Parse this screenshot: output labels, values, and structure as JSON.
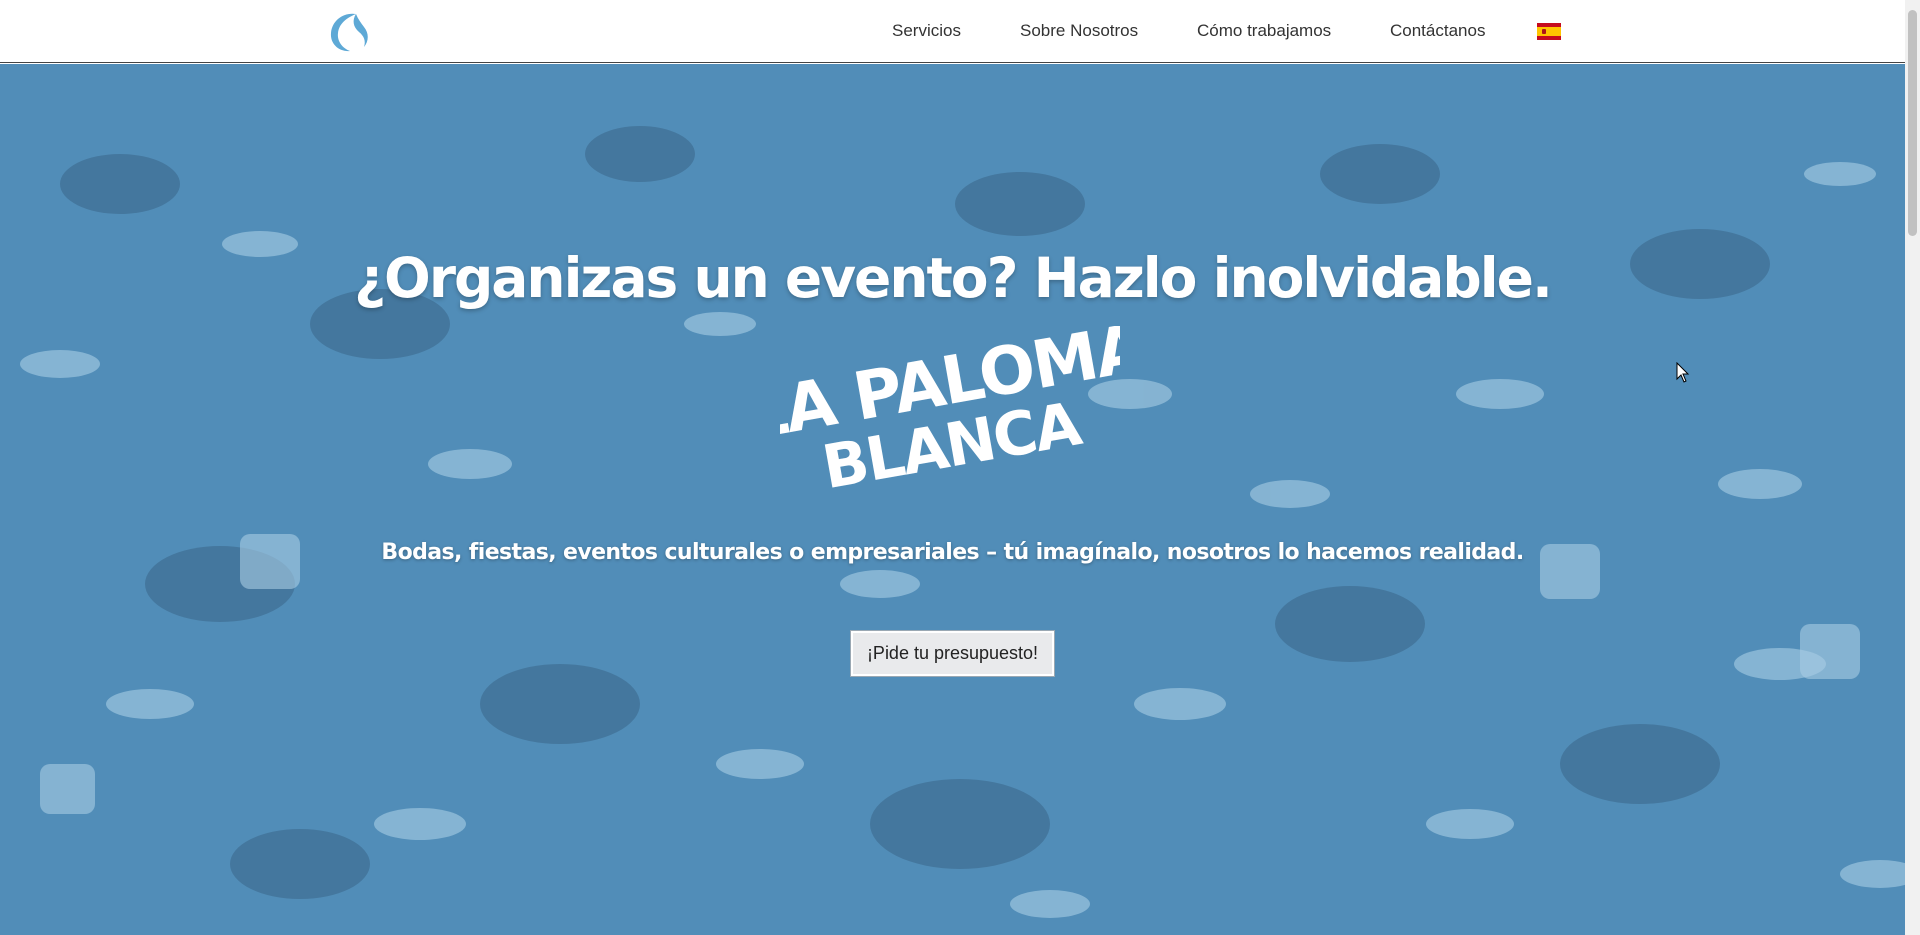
{
  "nav": {
    "logo_icon": "dove-icon",
    "links": [
      "Servicios",
      "Sobre Nosotros",
      "Cómo trabajamos",
      "Contáctanos"
    ],
    "language_icon": "spain-flag-icon"
  },
  "hero": {
    "title": "¿Organizas un evento? Hazlo inolvidable.",
    "brand_line1": "LA PALOMA",
    "brand_line2": "BLANCA",
    "subtitle": "Bodas, fiestas, eventos culturales o empresariales – tú imagínalo, nosotros lo hacemos realidad.",
    "cta_label": "¡Pide tu presupuesto!"
  },
  "colors": {
    "brand_blue": "#5ea9d6",
    "hero_overlay": "#5ca0cd",
    "nav_text": "#333333"
  }
}
